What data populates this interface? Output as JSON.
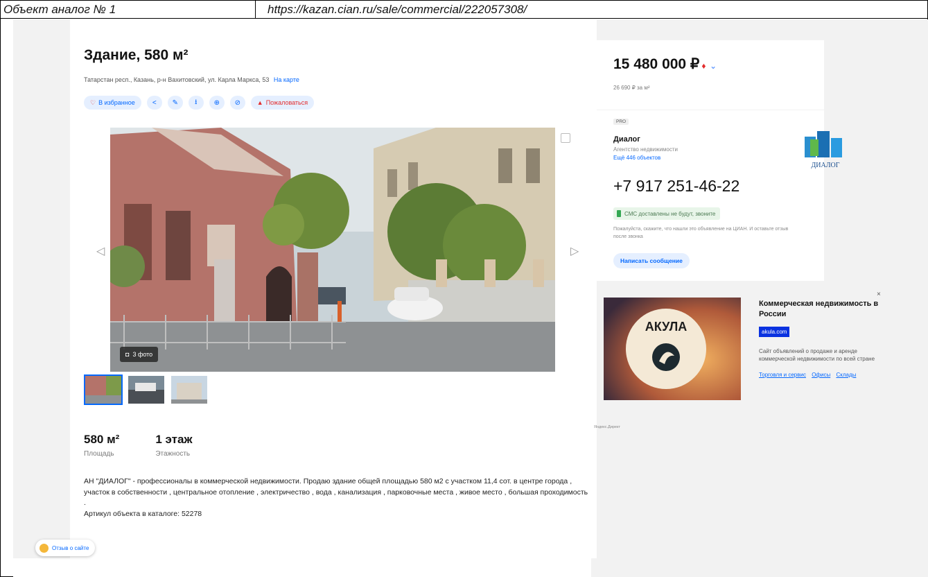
{
  "doc": {
    "label": "Объект аналог № 1",
    "url": "https://kazan.cian.ru/sale/commercial/222057308/"
  },
  "listing": {
    "title": "Здание, 580 м²",
    "address": "Татарстан респ., Казань, р-н Вахитовский, ул. Карла Маркса, 53",
    "map_link": "На карте",
    "actions": {
      "favorite": "В избранное",
      "complain": "Пожаловаться"
    },
    "photo_count": "3 фото",
    "stats": [
      {
        "value": "580 м²",
        "label": "Площадь"
      },
      {
        "value": "1 этаж",
        "label": "Этажность"
      }
    ],
    "description": "АН \"ДИАЛОГ\" - профессионалы в коммерческой недвижимости. Продаю здание общей площадью 580 м2 с участком 11,4 сот. в центре города , участок в собственности , центральное отопление , электричество , вода , канализация , парковочные места , живое место , большая проходимость .",
    "article": "Артикул объекта в каталоге: 52278"
  },
  "price": {
    "value": "15 480 000 ₽",
    "down_arrow": "♦",
    "more": "⌄",
    "per_meter": "26 690 ₽ за м²"
  },
  "agent": {
    "badge": "PRO",
    "name": "Диалог",
    "type": "Агентство недвижимости",
    "more_objects": "Ещё 446 объектов",
    "logo_text": "ДИАЛОГ",
    "phone": "+7 917 251-46-22",
    "sms_note": "СМС доставлены не будут, звоните",
    "notice": "Пожалуйста, скажите, что нашли это объявление на ЦИАН. И оставьте отзыв после звонка",
    "message_button": "Написать сообщение"
  },
  "ad": {
    "image_text": "АКУЛА",
    "title": "Коммерческая недвижимость в России",
    "domain": "akula.com",
    "description": "Сайт объявлений о продаже и аренде коммерческой недвижимости по всей стране",
    "links": [
      "Торговля и сервис",
      "Офисы",
      "Склады"
    ],
    "close": "×",
    "source": "Яндекс.Директ"
  },
  "feedback": {
    "label": "Отзыв о сайте"
  },
  "colors": {
    "accent": "#0468ff",
    "pill_bg": "#e5efff",
    "danger": "#e32d2d",
    "page_bg": "#f2f2f2"
  }
}
